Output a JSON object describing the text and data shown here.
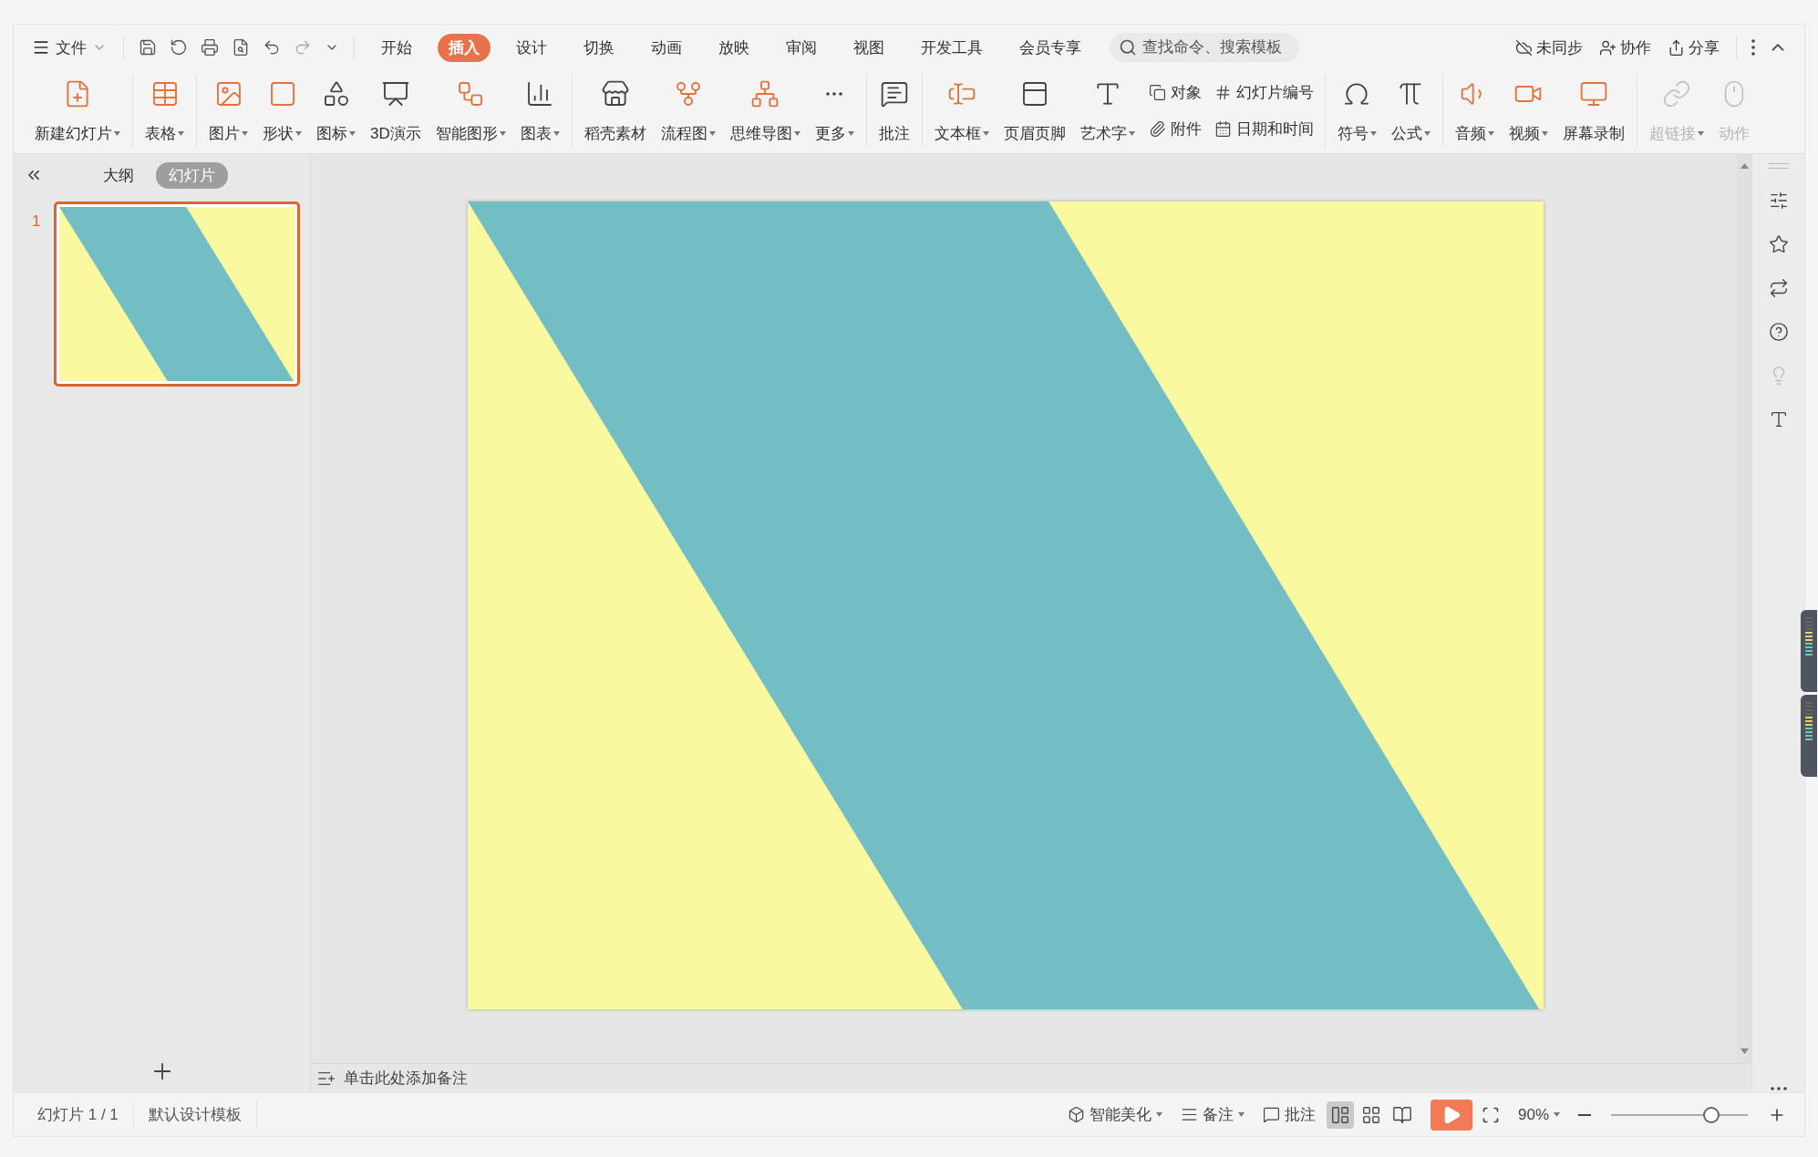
{
  "menu": {
    "file_label": "文件",
    "tabs": [
      {
        "label": "开始",
        "selected": false
      },
      {
        "label": "插入",
        "selected": true
      },
      {
        "label": "设计",
        "selected": false
      },
      {
        "label": "切换",
        "selected": false
      },
      {
        "label": "动画",
        "selected": false
      },
      {
        "label": "放映",
        "selected": false
      },
      {
        "label": "审阅",
        "selected": false
      },
      {
        "label": "视图",
        "selected": false
      },
      {
        "label": "开发工具",
        "selected": false
      },
      {
        "label": "会员专享",
        "selected": false
      }
    ],
    "search": {
      "placeholder": "查找命令、搜索模板"
    },
    "actions": [
      "未同步",
      "协作",
      "分享"
    ]
  },
  "ribbon": {
    "groups": [
      [
        {
          "kind": "large",
          "label": "新建幻灯片",
          "dropdown": true,
          "disabled": false
        }
      ],
      [
        {
          "kind": "large",
          "label": "表格",
          "dropdown": true,
          "disabled": false
        }
      ],
      [
        {
          "kind": "large",
          "label": "图片",
          "dropdown": true,
          "disabled": false
        },
        {
          "kind": "large",
          "label": "形状",
          "dropdown": true,
          "disabled": false
        },
        {
          "kind": "large",
          "label": "图标",
          "dropdown": true,
          "disabled": false
        },
        {
          "kind": "large",
          "label": "3D演示",
          "dropdown": false,
          "disabled": false
        },
        {
          "kind": "large",
          "label": "智能图形",
          "dropdown": true,
          "disabled": false
        },
        {
          "kind": "large",
          "label": "图表",
          "dropdown": true,
          "disabled": false
        }
      ],
      [
        {
          "kind": "large",
          "label": "稻壳素材",
          "dropdown": false,
          "disabled": false
        },
        {
          "kind": "large",
          "label": "流程图",
          "dropdown": true,
          "disabled": false
        },
        {
          "kind": "large",
          "label": "思维导图",
          "dropdown": true,
          "disabled": false
        },
        {
          "kind": "large",
          "label": "更多",
          "dropdown": true,
          "disabled": false
        }
      ],
      [
        {
          "kind": "large",
          "label": "批注",
          "dropdown": false,
          "disabled": false
        }
      ],
      [
        {
          "kind": "large",
          "label": "文本框",
          "dropdown": true,
          "disabled": false
        },
        {
          "kind": "large",
          "label": "页眉页脚",
          "dropdown": false,
          "disabled": false
        },
        {
          "kind": "large",
          "label": "艺术字",
          "dropdown": true,
          "disabled": false
        },
        {
          "kind": "small",
          "label": "对象",
          "dropdown": false,
          "disabled": false
        },
        {
          "kind": "small",
          "label": "附件",
          "dropdown": false,
          "disabled": false
        },
        {
          "kind": "small",
          "label": "幻灯片编号",
          "dropdown": false,
          "disabled": false
        },
        {
          "kind": "small",
          "label": "日期和时间",
          "dropdown": false,
          "disabled": false
        }
      ],
      [
        {
          "kind": "large",
          "label": "符号",
          "dropdown": true,
          "disabled": false
        },
        {
          "kind": "large",
          "label": "公式",
          "dropdown": true,
          "disabled": false
        }
      ],
      [
        {
          "kind": "large",
          "label": "音频",
          "dropdown": true,
          "disabled": false
        },
        {
          "kind": "large",
          "label": "视频",
          "dropdown": true,
          "disabled": false
        },
        {
          "kind": "large",
          "label": "屏幕录制",
          "dropdown": false,
          "disabled": false
        }
      ],
      [
        {
          "kind": "large",
          "label": "超链接",
          "dropdown": true,
          "disabled": true
        },
        {
          "kind": "large",
          "label": "动作",
          "dropdown": false,
          "disabled": true
        }
      ]
    ]
  },
  "panel": {
    "tabs": [
      {
        "label": "大纲",
        "selected": false
      },
      {
        "label": "幻灯片",
        "selected": true
      }
    ],
    "slides": [
      {
        "number": "1",
        "selected": true
      }
    ]
  },
  "notes": {
    "placeholder": "单击此处添加备注"
  },
  "status": {
    "slide_info": "幻灯片 1 / 1",
    "template": "默认设计模板",
    "beautify": "智能美化",
    "notes": "备注",
    "comments": "批注",
    "views": [
      {
        "selected": true
      },
      {
        "selected": false
      },
      {
        "selected": false
      }
    ],
    "zoom": "90%",
    "zoom_slider": {
      "level": 0.73
    }
  }
}
